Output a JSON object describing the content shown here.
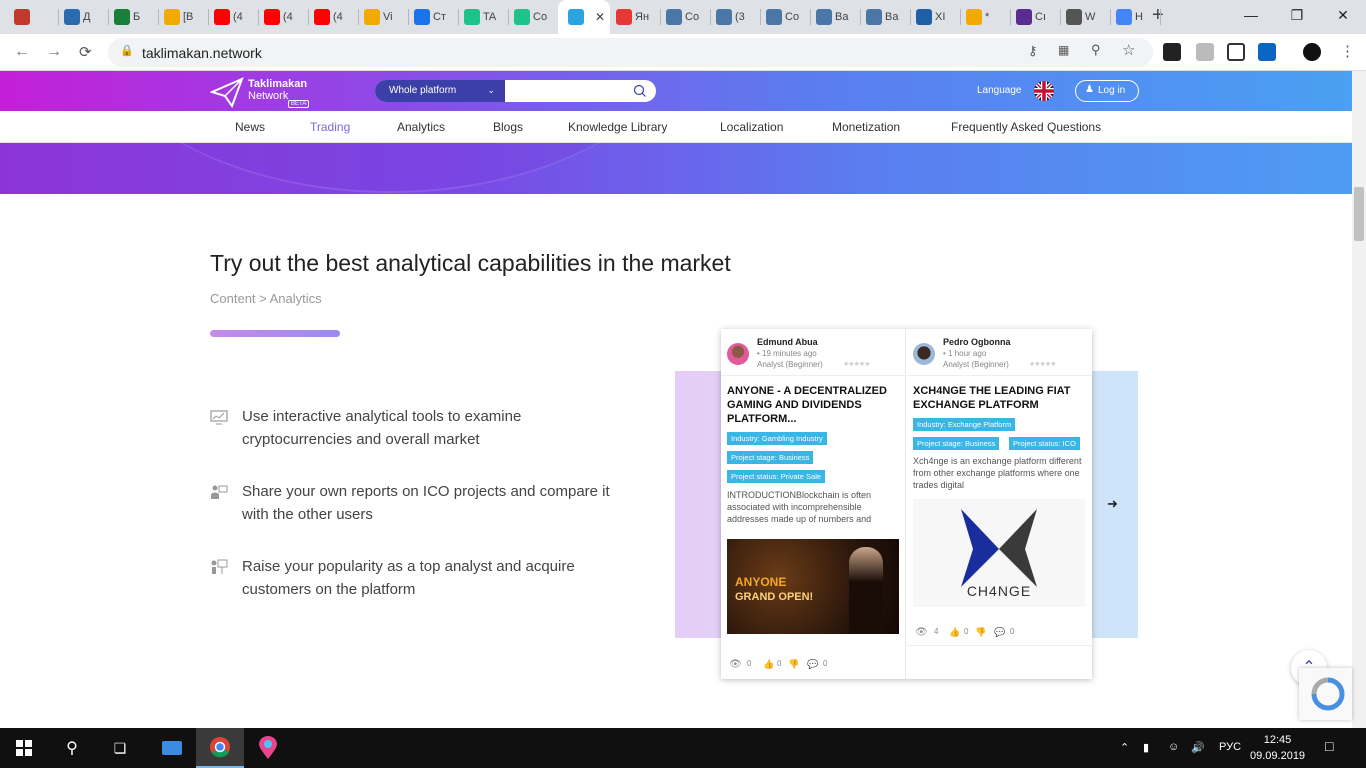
{
  "browser": {
    "tabs": [
      {
        "label": "",
        "icon": "paperclip-icon",
        "color": "#c0392b"
      },
      {
        "label": "Д",
        "icon": "x-icon",
        "color": "#2b6cb0"
      },
      {
        "label": "Б",
        "icon": "sheets-icon",
        "color": "#188038"
      },
      {
        "label": "[В",
        "icon": "bitcoin-icon",
        "color": "#f2a900"
      },
      {
        "label": "(4",
        "icon": "youtube-icon",
        "color": "#ff0000"
      },
      {
        "label": "(4",
        "icon": "youtube-icon",
        "color": "#ff0000"
      },
      {
        "label": "(4",
        "icon": "youtube-icon",
        "color": "#ff0000"
      },
      {
        "label": "Vi",
        "icon": "bitcoin-icon",
        "color": "#f2a900"
      },
      {
        "label": "Cт",
        "icon": "check-icon",
        "color": "#1a73e8"
      },
      {
        "label": "TA",
        "icon": "chat-icon",
        "color": "#1ec28b"
      },
      {
        "label": "Co",
        "icon": "chat-icon",
        "color": "#1ec28b"
      },
      {
        "label": "",
        "icon": "telegram-icon",
        "color": "#2aa3e0",
        "active": true
      },
      {
        "label": "Ян",
        "icon": "yandex-icon",
        "color": "#e53935"
      },
      {
        "label": "Co",
        "icon": "message-icon",
        "color": "#4a76a8"
      },
      {
        "label": "(3",
        "icon": "vk-icon",
        "color": "#4a76a8"
      },
      {
        "label": "Co",
        "icon": "message-icon",
        "color": "#4a76a8"
      },
      {
        "label": "Ва",
        "icon": "vk-icon",
        "color": "#4a76a8"
      },
      {
        "label": "Ва",
        "icon": "vk-icon",
        "color": "#4a76a8"
      },
      {
        "label": "XI",
        "icon": "cd-icon",
        "color": "#1f5fa8"
      },
      {
        "label": "*",
        "icon": "bitcoin-icon",
        "color": "#f2a900"
      },
      {
        "label": "Cı",
        "icon": "list-icon",
        "color": "#5b2c8f"
      },
      {
        "label": "W",
        "icon": "spy-icon",
        "color": "#555555"
      },
      {
        "label": "H",
        "icon": "google-icon",
        "color": "#4285f4"
      }
    ],
    "url": "taklimakan.network"
  },
  "site": {
    "logo_line1": "Taklimakan",
    "logo_line2": "Network",
    "logo_badge": "BETA",
    "search_scope": "Whole platform",
    "search_value": "",
    "language_label": "Language",
    "login_label": "Log in",
    "menu": [
      "News",
      "Trading",
      "Analytics",
      "Blogs",
      "Knowledge Library",
      "Localization",
      "Monetization",
      "Frequently Asked Questions"
    ],
    "menu_active": "Trading"
  },
  "main": {
    "headline": "Try out the best analytical capabilities in the market",
    "breadcrumb": "Content > Analytics",
    "features": [
      {
        "line1": "Use interactive analytical tools to examine",
        "line2": "cryptocurrencies and overall market",
        "icon": "monitor-chart-icon"
      },
      {
        "line1": "Share your own reports on ICO projects and compare it",
        "line2": "with the other users",
        "icon": "presentation-icon"
      },
      {
        "line1": "Raise your popularity as a top analyst and acquire",
        "line2": "customers on the platform",
        "icon": "trophy-chart-icon"
      }
    ]
  },
  "cards": [
    {
      "author": "Edmund Abua",
      "time": "• 19 minutes ago",
      "rank": "Analyst (Beginner)",
      "stars": "★★★★★",
      "title": "ANYONE - A DECENTRALIZED GAMING AND DIVIDENDS PLATFORM...",
      "tags": [
        "Industry: Gambling Industry",
        "Project stage: Business",
        "Project status: Private Sale"
      ],
      "desc": "INTRODUCTIONBlockchain is often associated with incomprehensible addresses made up of numbers and",
      "image_text1": "ANYONE",
      "image_text2": "GRAND OPEN!",
      "views": "0",
      "likes": "0",
      "comments": "0"
    },
    {
      "author": "Pedro Ogbonna",
      "time": "• 1 hour ago",
      "rank": "Analyst (Beginner)",
      "stars": "★★★★★",
      "title": "XCH4NGE THE LEADING FIAT EXCHANGE PLATFORM",
      "tags": [
        "Industry: Exchange Platform",
        "Project stage: Business",
        "Project status: ICO"
      ],
      "desc": "Xch4nge is an exchange platform different from other exchange platforms where one trades digital",
      "image_text1": "CH4NGE",
      "views": "4",
      "likes": "0",
      "comments": "0"
    }
  ],
  "taskbar": {
    "lang": "РУС",
    "time": "12:45",
    "date": "09.09.2019"
  }
}
